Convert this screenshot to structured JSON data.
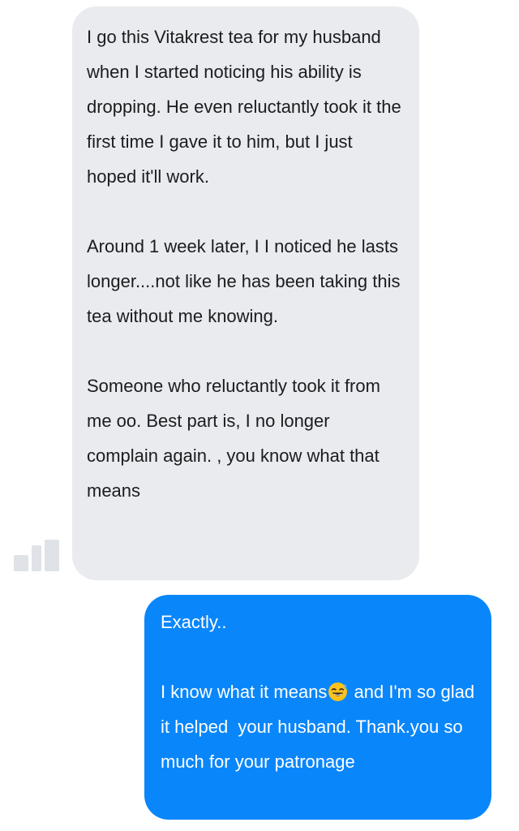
{
  "conversation": {
    "incoming_message": {
      "paragraphs": [
        "I go this Vitakrest tea for my husband when I started noticing his ability is dropping. He even reluctantly took it the first time I gave it to him, but I just hoped it'll work.",
        "Around 1 week later, I I noticed he lasts longer....not like he has been taking this tea without me knowing.",
        "Someone who reluctantly took it from me oo. Best part is, I no longer complain again. , you know what that means"
      ],
      "bubble_color": "#e9ebef",
      "text_color": "#1c1c1e"
    },
    "outgoing_message": {
      "line1": "Exactly..",
      "line2_before_emoji": "I know what it means",
      "emoji_icon": "grinning-face-with-sweat",
      "line2_after_emoji": " and I'm so glad it helped  your husband. Thank.you so much for your patronage",
      "bubble_color": "#0a86fb",
      "text_color": "#ffffff"
    },
    "avatar": {
      "icon": "blurred-avatar"
    }
  }
}
